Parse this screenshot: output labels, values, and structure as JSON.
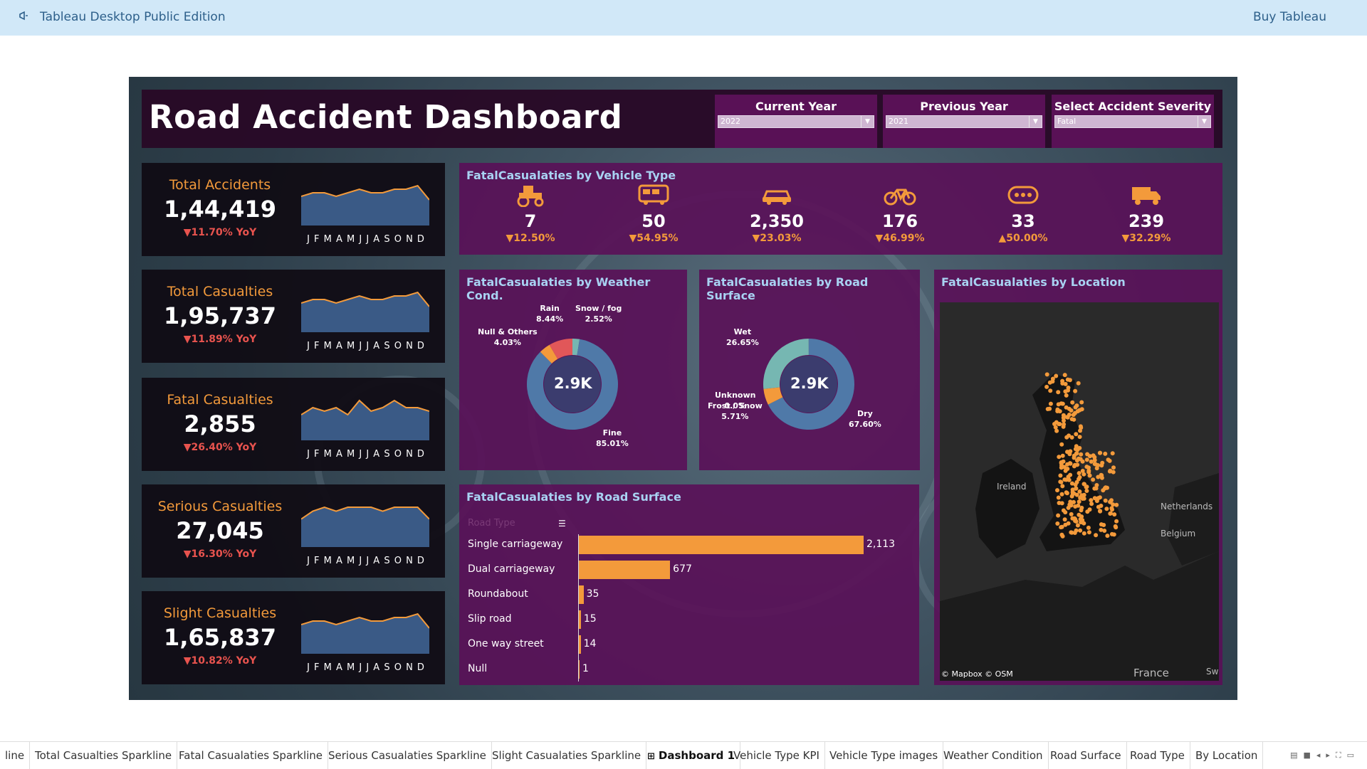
{
  "app": {
    "title": "Tableau Desktop Public Edition",
    "buy": "Buy Tableau"
  },
  "dashboard": {
    "title": "Road Accident Dashboard",
    "filters": [
      {
        "label": "Current Year",
        "value": "2022"
      },
      {
        "label": "Previous Year",
        "value": "2021"
      },
      {
        "label": "Select Accident Severity",
        "value": "Fatal"
      }
    ],
    "months": "J F M A M J J A S O N D",
    "kpis": [
      {
        "label": "Total Accidents",
        "value": "1,44,419",
        "yoy": "▼11.70% YoY",
        "spark": [
          7,
          8,
          8,
          7,
          8,
          9,
          8,
          8,
          9,
          9,
          10,
          6
        ]
      },
      {
        "label": "Total Casualties",
        "value": "1,95,737",
        "yoy": "▼11.89% YoY",
        "spark": [
          7,
          8,
          8,
          7,
          8,
          9,
          8,
          8,
          9,
          9,
          10,
          6
        ]
      },
      {
        "label": "Fatal Casualties",
        "value": "2,855",
        "yoy": "▼26.40% YoY",
        "spark": [
          6,
          8,
          7,
          8,
          6,
          10,
          7,
          8,
          10,
          8,
          8,
          7
        ]
      },
      {
        "label": "Serious Casualties",
        "value": "27,045",
        "yoy": "▼16.30% YoY",
        "spark": [
          6,
          8,
          9,
          8,
          9,
          9,
          9,
          8,
          9,
          9,
          9,
          6
        ]
      },
      {
        "label": "Slight Casualties",
        "value": "1,65,837",
        "yoy": "▼10.82% YoY",
        "spark": [
          7,
          8,
          8,
          7,
          8,
          9,
          8,
          8,
          9,
          9,
          10,
          6
        ]
      }
    ],
    "vehicle": {
      "title": "FatalCasualaties by Vehicle Type",
      "items": [
        {
          "icon": "tractor-icon",
          "value": "7",
          "change": "▼12.50%"
        },
        {
          "icon": "bus-icon",
          "value": "50",
          "change": "▼54.95%"
        },
        {
          "icon": "car-icon",
          "value": "2,350",
          "change": "▼23.03%"
        },
        {
          "icon": "bicycle-icon",
          "value": "176",
          "change": "▼46.99%"
        },
        {
          "icon": "other-vehicle-icon",
          "value": "33",
          "change": "▲50.00%"
        },
        {
          "icon": "truck-icon",
          "value": "239",
          "change": "▼32.29%"
        }
      ]
    },
    "weather": {
      "title": "FatalCasualaties by Weather Cond.",
      "center": "2.9K",
      "labels": {
        "rain": "Rain\n8.44%",
        "snow": "Snow / fog\n2.52%",
        "null": "Null & Others\n4.03%",
        "fine": "Fine\n85.01%"
      }
    },
    "surface_donut": {
      "title": "FatalCasualaties by Road Surface",
      "center": "2.9K",
      "labels": {
        "wet": "Wet\n26.65%",
        "unknown": "Unknown\n0.0%",
        "frost": "Frost / Snow\n5.71%",
        "dry": "Dry\n67.60%"
      }
    },
    "location": {
      "title": "FatalCasualaties by Location",
      "credit": "© Mapbox © OSM",
      "places": {
        "ireland": "Ireland",
        "netherlands": "Netherlands",
        "belgium": "Belgium",
        "france": "France",
        "sw": "Sw"
      }
    },
    "road_type": {
      "title": "FatalCasualaties by Road Surface",
      "column_header": "Road Type"
    },
    "colors": {
      "accent": "#f39a3b",
      "donut_blue": "#4f79a8",
      "donut_teal": "#76b7b2",
      "donut_red": "#e15759",
      "panel": "#5a1058"
    }
  },
  "chart_data": {
    "type": "bar",
    "categories": [
      "Single carriageway",
      "Dual carriageway",
      "Roundabout",
      "Slip road",
      "One way street",
      "Null"
    ],
    "values": [
      2113,
      677,
      35,
      15,
      14,
      1
    ],
    "labels": [
      "2,113",
      "677",
      "35",
      "15",
      "14",
      "1"
    ],
    "title": "FatalCasualaties by Road Surface",
    "xlabel": "",
    "ylabel": "Road Type"
  },
  "tabs": [
    "line",
    "Total Casualties Sparkline",
    "Fatal Casualaties Sparkline",
    "Serious Casualaties Sparkline",
    "Slight Casualaties Sparkline",
    "Dashboard 1",
    "Vehicle Type KPI",
    "Vehicle Type images",
    "Weather Condition",
    "Road Surface",
    "Road Type",
    "By Location"
  ]
}
